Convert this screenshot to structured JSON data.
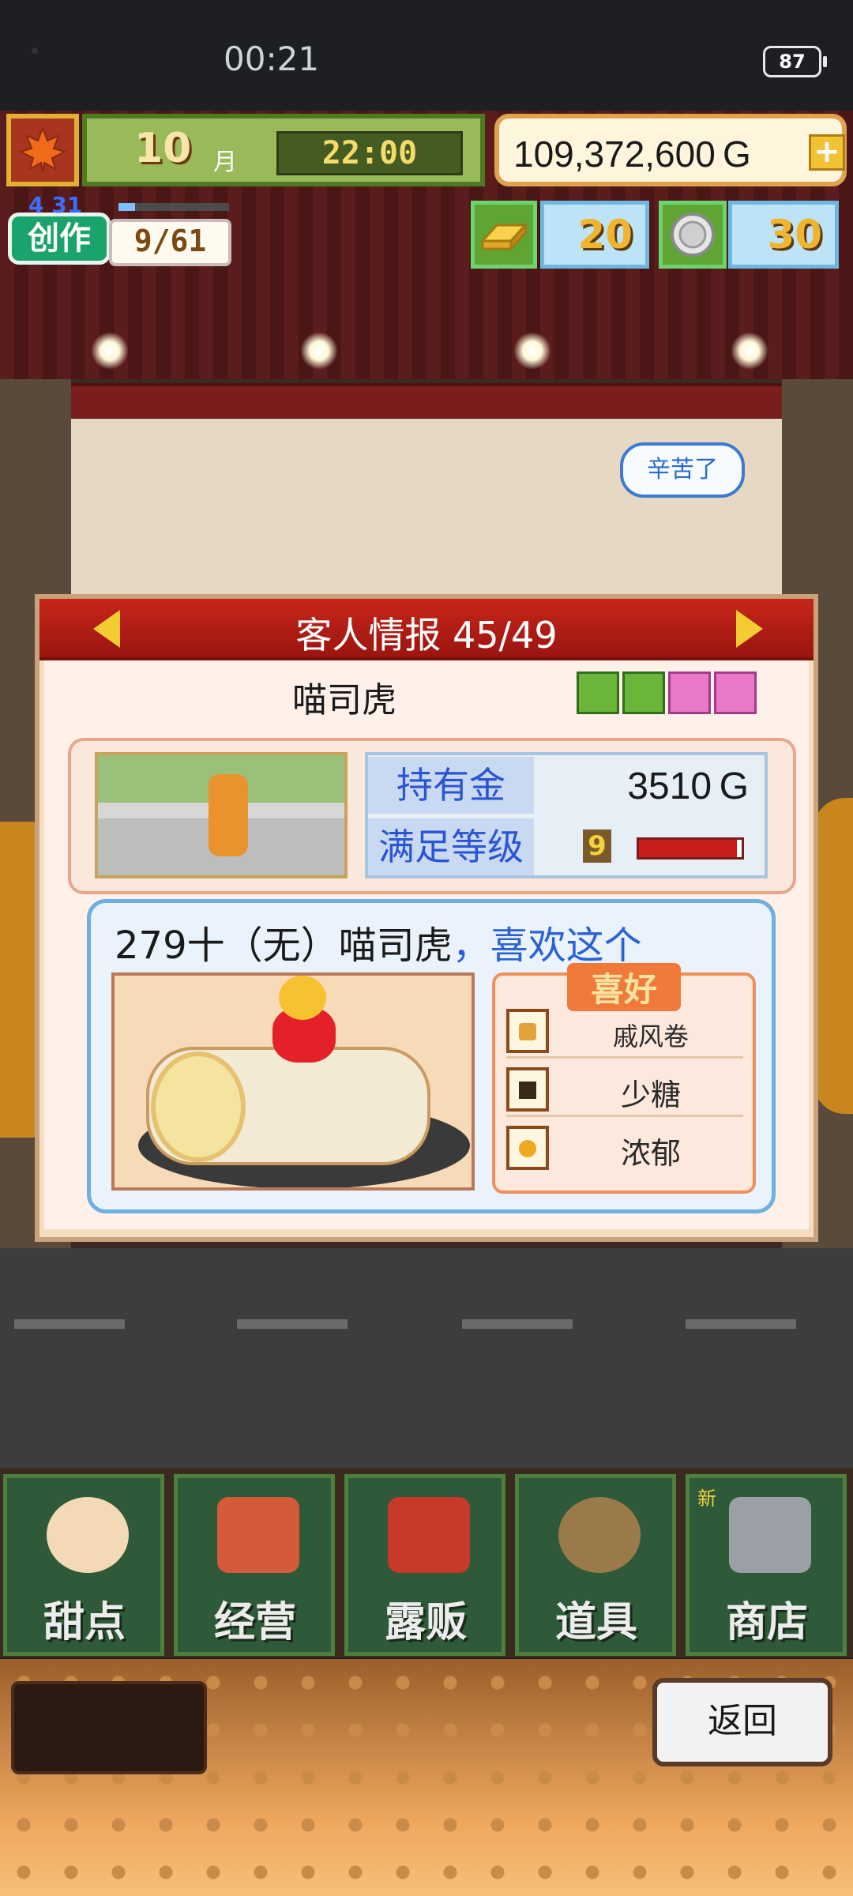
{
  "status_bar": {
    "time": "00:21",
    "battery": "87"
  },
  "hud": {
    "month_number": "10",
    "month_label": "月",
    "clock": "22:00",
    "money": "109,372,600 G",
    "money_add": "+",
    "create_label": "创作",
    "create_date": "4 31",
    "create_count": "9/61",
    "create_progress": 0.15,
    "gold_bars": "20",
    "medals": "30"
  },
  "scene": {
    "speech_bubble": "辛苦了"
  },
  "panel": {
    "title": "客人情报 45/49",
    "customer_name": "喵司虎",
    "gifts": [
      "green",
      "green",
      "pink",
      "pink"
    ],
    "stats": {
      "money_label": "持有金",
      "money_value": "3510 G",
      "satisfaction_label": "满足等级",
      "satisfaction_value": "9",
      "satisfaction_progress": 0.95
    },
    "preference": {
      "text_black": "279十（无）喵司虎",
      "text_blue": "，喜欢这个",
      "hobby_title": "喜好",
      "hobbies": [
        {
          "label": "戚风卷",
          "icon": "cake-roll-icon",
          "color": "#e5a23a"
        },
        {
          "label": "少糖",
          "icon": "sugar-icon",
          "color": "#3a2a1a"
        },
        {
          "label": "浓郁",
          "icon": "rich-flavor-icon",
          "color": "#f0a820"
        }
      ]
    }
  },
  "nav": {
    "items": [
      {
        "label": "甜点",
        "icon": "cake-icon",
        "color": "#f4d9b6"
      },
      {
        "label": "经营",
        "icon": "shop-icon",
        "color": "#d45a3a"
      },
      {
        "label": "露贩",
        "icon": "food-truck-icon",
        "color": "#c73a2a"
      },
      {
        "label": "道具",
        "icon": "items-icon",
        "color": "#9a7a4a"
      },
      {
        "label": "商店",
        "icon": "cart-icon",
        "color": "#9aa0a6"
      }
    ],
    "new_badge": "新"
  },
  "footer": {
    "back_button": "返回"
  }
}
